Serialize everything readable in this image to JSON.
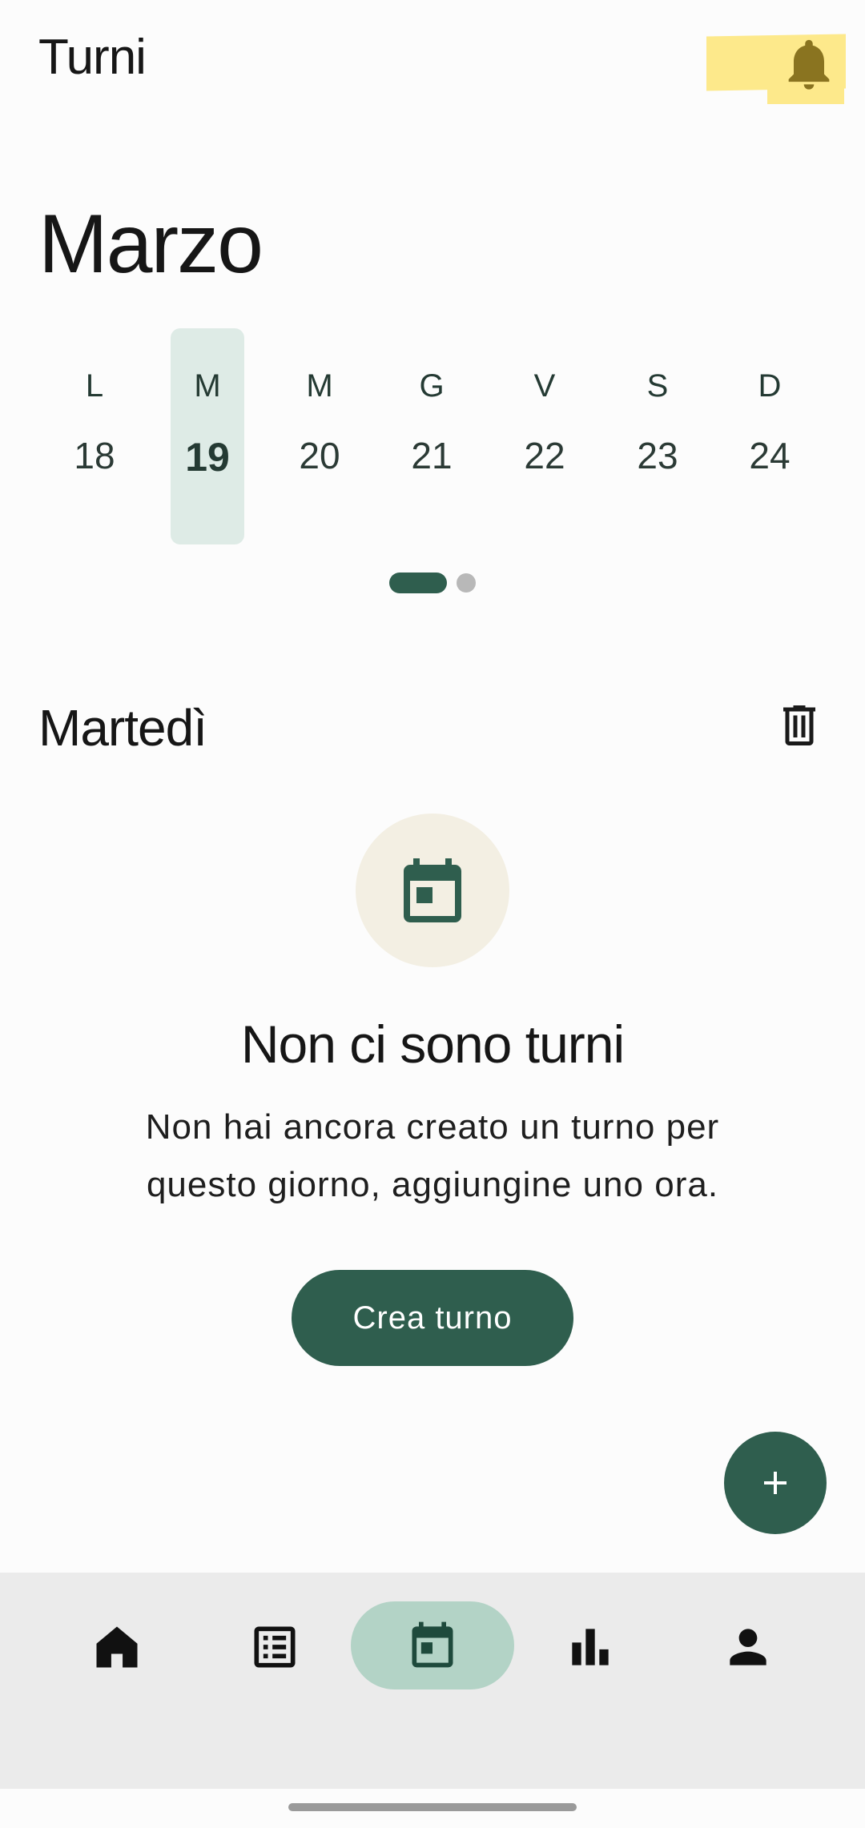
{
  "header": {
    "title": "Turni",
    "notifications_icon": "bell-icon"
  },
  "calendar": {
    "month": "Marzo",
    "days": [
      {
        "letter": "L",
        "number": "18",
        "selected": false
      },
      {
        "letter": "M",
        "number": "19",
        "selected": true
      },
      {
        "letter": "M",
        "number": "20",
        "selected": false
      },
      {
        "letter": "G",
        "number": "21",
        "selected": false
      },
      {
        "letter": "V",
        "number": "22",
        "selected": false
      },
      {
        "letter": "S",
        "number": "23",
        "selected": false
      },
      {
        "letter": "D",
        "number": "24",
        "selected": false
      }
    ],
    "pager": {
      "pages": 2,
      "active": 1
    }
  },
  "day_section": {
    "title": "Martedì",
    "delete_icon": "trash-icon"
  },
  "empty_state": {
    "icon": "calendar-icon",
    "title": "Non ci sono turni",
    "line1": "Non hai ancora creato un turno per",
    "line2": "questo giorno, aggiungine uno ora.",
    "button_label": "Crea turno"
  },
  "fab": {
    "icon": "plus-icon"
  },
  "bottom_nav": {
    "items": [
      {
        "icon": "home-icon",
        "active": false
      },
      {
        "icon": "list-icon",
        "active": false
      },
      {
        "icon": "calendar-icon",
        "active": true
      },
      {
        "icon": "bar-chart-icon",
        "active": false
      },
      {
        "icon": "person-icon",
        "active": false
      }
    ]
  },
  "colors": {
    "primary": "#2f5e4e",
    "selected_day_bg": "#deebe6",
    "nav_active_bg": "#b3d3c6",
    "highlight": "#fde98b",
    "bell": "#8a7420",
    "empty_circle": "#f3efe3"
  }
}
